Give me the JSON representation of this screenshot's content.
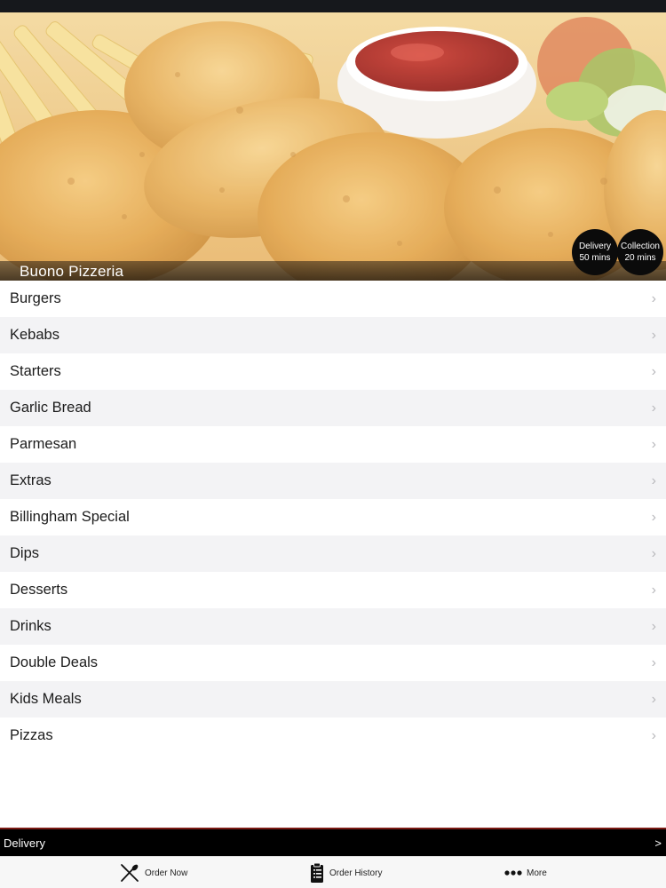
{
  "hero": {
    "restaurant_name": "Buono Pizzeria",
    "image_icon": "fried-chicken-photo",
    "badges": {
      "delivery": {
        "label": "Delivery",
        "time": "50 mins"
      },
      "collection": {
        "label": "Collection",
        "time": "20 mins"
      }
    }
  },
  "menu": {
    "chevron_icon": "chevron-right-icon",
    "items": [
      {
        "label": "Burgers"
      },
      {
        "label": "Kebabs"
      },
      {
        "label": "Starters"
      },
      {
        "label": "Garlic Bread"
      },
      {
        "label": "Parmesan"
      },
      {
        "label": "Extras"
      },
      {
        "label": "Billingham Special"
      },
      {
        "label": "Dips"
      },
      {
        "label": "Desserts"
      },
      {
        "label": "Drinks"
      },
      {
        "label": "Double Deals"
      },
      {
        "label": "Kids Meals"
      },
      {
        "label": "Pizzas"
      }
    ]
  },
  "delivery_bar": {
    "label": "Delivery",
    "arrow": ">"
  },
  "tabs": {
    "order_now": {
      "label": "Order Now",
      "icon": "fork-knife-icon"
    },
    "order_history": {
      "label": "Order History",
      "icon": "clipboard-icon"
    },
    "more": {
      "label": "More",
      "icon": "ellipsis-icon"
    }
  },
  "colors": {
    "status_bar": "#16181c",
    "row_alt": "#f3f3f5",
    "badge": "#0b0b0b",
    "delivery_bar": "#000000",
    "delivery_bar_border": "#7a1a14",
    "tab_bar": "#f7f7f7"
  }
}
